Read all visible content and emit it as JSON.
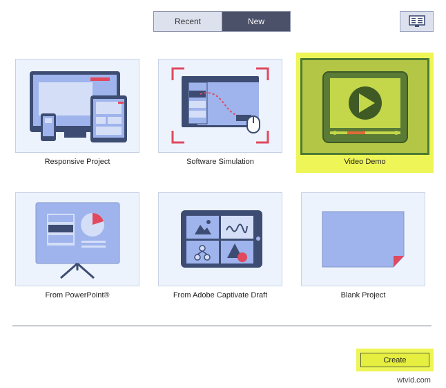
{
  "tabs": {
    "recent": "Recent",
    "new": "New"
  },
  "view_toggle_icon": "presentation-view-icon",
  "cards": [
    {
      "label": "Responsive Project",
      "icon": "responsive-devices-icon"
    },
    {
      "label": "Software Simulation",
      "icon": "software-simulation-icon"
    },
    {
      "label": "Video Demo",
      "icon": "video-play-icon",
      "selected": true
    },
    {
      "label": "From PowerPoint®",
      "icon": "powerpoint-presentation-icon"
    },
    {
      "label": "From Adobe Captivate Draft",
      "icon": "captivate-draft-tablet-icon"
    },
    {
      "label": "Blank Project",
      "icon": "blank-page-icon"
    }
  ],
  "create_button": "Create",
  "watermark": "wtvid.com",
  "colors": {
    "tab_active": "#4a5168",
    "highlight_yellow": "#eef556",
    "selected_card": "#b4c645",
    "selected_border": "#4d7a33",
    "icon_dark": "#3d4c72",
    "icon_light": "#9fb4ec"
  }
}
